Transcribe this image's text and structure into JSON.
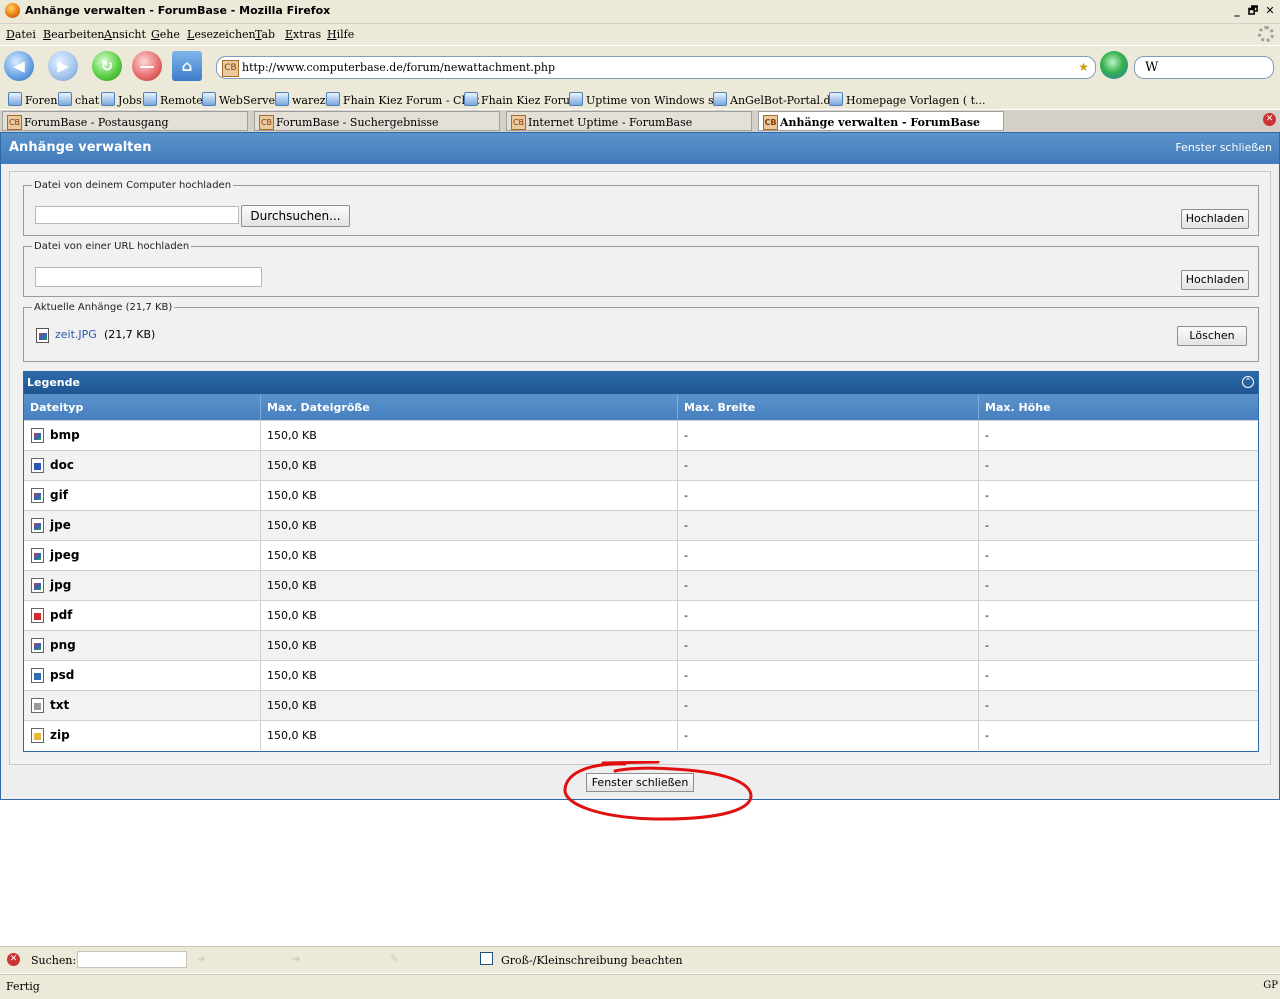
{
  "window": {
    "title": "Anhänge verwalten - ForumBase - Mozilla Firefox",
    "buttons": [
      "_",
      "🗗",
      "✕"
    ]
  },
  "menu": [
    "Datei",
    "Bearbeiten",
    "Ansicht",
    "Gehe",
    "Lesezeichen",
    "Tab",
    "Extras",
    "Hilfe"
  ],
  "navbar": {
    "url": "http://www.computerbase.de/forum/newattachment.php",
    "search_value": "W"
  },
  "bookmarks": [
    "Foren",
    "chat",
    "Jobs",
    "Remote",
    "WebServer",
    "warez",
    "Fhain Kiez Forum - Chat",
    "Fhain Kiez Forum",
    "Uptime von Windows s...",
    "AnGelBot-Portal.de",
    "Homepage Vorlagen ( t..."
  ],
  "tabs": [
    "ForumBase - Postausgang",
    "ForumBase - Suchergebnisse",
    "Internet Uptime - ForumBase",
    "Anhänge verwalten - ForumBase"
  ],
  "page": {
    "title": "Anhänge verwalten",
    "close_link": "Fenster schließen",
    "upload_computer": {
      "legend": "Datei von deinem Computer hochladen",
      "browse_label": "Durchsuchen...",
      "upload_label": "Hochladen"
    },
    "upload_url": {
      "legend": "Datei von einer URL hochladen",
      "upload_label": "Hochladen"
    },
    "current": {
      "legend": "Aktuelle Anhänge (21,7 KB)",
      "file_name": "zeit.JPG",
      "file_size": "(21,7 KB)",
      "delete_label": "Löschen"
    },
    "legend_table": {
      "title": "Legende",
      "columns": [
        "Dateityp",
        "Max. Dateigröße",
        "Max. Breite",
        "Max. Höhe"
      ],
      "rows": [
        {
          "type": "bmp",
          "size": "150,0 KB",
          "width": "-",
          "height": "-"
        },
        {
          "type": "doc",
          "size": "150,0 KB",
          "width": "-",
          "height": "-"
        },
        {
          "type": "gif",
          "size": "150,0 KB",
          "width": "-",
          "height": "-"
        },
        {
          "type": "jpe",
          "size": "150,0 KB",
          "width": "-",
          "height": "-"
        },
        {
          "type": "jpeg",
          "size": "150,0 KB",
          "width": "-",
          "height": "-"
        },
        {
          "type": "jpg",
          "size": "150,0 KB",
          "width": "-",
          "height": "-"
        },
        {
          "type": "pdf",
          "size": "150,0 KB",
          "width": "-",
          "height": "-"
        },
        {
          "type": "png",
          "size": "150,0 KB",
          "width": "-",
          "height": "-"
        },
        {
          "type": "psd",
          "size": "150,0 KB",
          "width": "-",
          "height": "-"
        },
        {
          "type": "txt",
          "size": "150,0 KB",
          "width": "-",
          "height": "-"
        },
        {
          "type": "zip",
          "size": "150,0 KB",
          "width": "-",
          "height": "-"
        }
      ]
    },
    "bottom_close_label": "Fenster schließen"
  },
  "findbar": {
    "label": "Suchen:",
    "case_label": "Groß-/Kleinschreibung beachten"
  },
  "status": {
    "text": "Fertig",
    "right": "GP"
  },
  "colors": {
    "header_blue": "#3f7abb",
    "legend_blue": "#1f5592",
    "annotation_red": "#e01010"
  }
}
